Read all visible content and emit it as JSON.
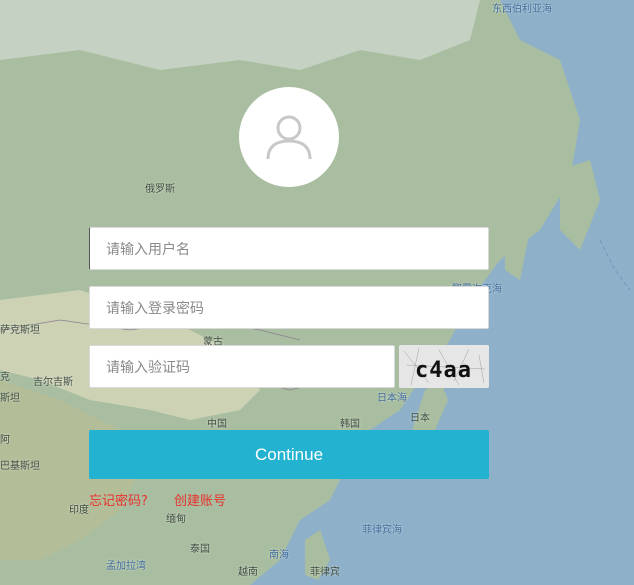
{
  "map": {
    "labels": {
      "east_siberian_sea": "东西伯利亚海",
      "russia": "俄罗斯",
      "sea_of_okhotsk": "鄂霍次克海",
      "kazakhstan": "萨克斯坦",
      "mongolia": "蒙古",
      "kyrgyzstan": "克",
      "urumqi": "吉尔吉斯",
      "tajikistan": "斯坦",
      "afghanistan": "阿",
      "pakistan": "巴基斯坦",
      "china": "中国",
      "korea": "韩国",
      "sea_of_japan": "日本海",
      "japan": "日本",
      "india": "印度",
      "myanmar": "缅甸",
      "thailand": "泰国",
      "bangladesh": "孟加拉湾",
      "vietnam": "越南",
      "south_china_sea": "南海",
      "philippine_sea": "菲律宾海",
      "philippines": "菲律宾"
    }
  },
  "login": {
    "username_placeholder": "请输入用户名",
    "password_placeholder": "请输入登录密码",
    "captcha_placeholder": "请输入验证码",
    "captcha_text": "c4aa",
    "continue_label": "Continue",
    "forgot_password": "忘记密码?",
    "create_account": "创建账号"
  }
}
